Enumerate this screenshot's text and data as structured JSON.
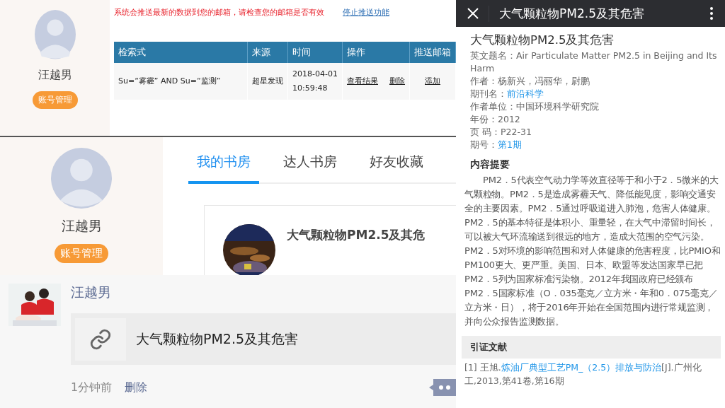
{
  "push_panel": {
    "profile": {
      "name": "汪越男",
      "button": "账号管理"
    },
    "notice": "系统会推送最新的数据到您的邮箱，请检查您的邮箱是否有效",
    "stop_link": "停止推送功能",
    "table": {
      "columns": [
        "检索式",
        "来源",
        "时间",
        "操作",
        "推送邮箱"
      ],
      "rows": [
        {
          "query": "Su=“雾霾” AND Su=“监测”",
          "source": "超星发现",
          "date": "2018-04-01",
          "time": "10:59:48",
          "view": "查看结果",
          "delete": "删除",
          "add": "添加"
        }
      ]
    }
  },
  "library_panel": {
    "profile": {
      "name": "汪越男",
      "button": "账号管理"
    },
    "tabs": [
      {
        "label": "我的书房",
        "selected": true
      },
      {
        "label": "达人书房",
        "selected": false
      },
      {
        "label": "好友收藏",
        "selected": false
      }
    ],
    "book": {
      "title": "大气颗粒物PM2.5及其危"
    }
  },
  "moment_panel": {
    "name": "汪越男",
    "link_title": "大气颗粒物PM2.5及其危害",
    "time": "1分钟前",
    "delete": "删除"
  },
  "article": {
    "header_title": "大气颗粒物PM2.5及其危害",
    "title": "大气颗粒物PM2.5及其危害",
    "fields": [
      {
        "label": "英文题名：",
        "value": "Air Particulate Matter PM2.5 in Beijing and Its Harm",
        "kind": "text"
      },
      {
        "label": "作者：",
        "value": "杨新兴，冯丽华，尉鹏",
        "kind": "text"
      },
      {
        "label": "期刊名：",
        "value": "前沿科学",
        "kind": "link"
      },
      {
        "label": "作者单位：",
        "value": "中国环境科学研究院",
        "kind": "text"
      },
      {
        "label": "年份：",
        "value": "2012",
        "kind": "text"
      },
      {
        "label": "页 码：",
        "value": "P22-31",
        "kind": "text"
      },
      {
        "label": "期号：",
        "value": "第1期",
        "kind": "link"
      }
    ],
    "abstract_heading": "内容提要",
    "abstract": "PM2．5代表空气动力学等效直径等于和小于2．5微米的大气颗粒物。PM2．5是造成雾霾天气、降低能见度，影响交通安全的主要因素。PM2．5通过呼吸道进入肺泡，危害人体健康。PM2．5的基本特征是体积小、重量轻，在大气中滞留时间长，可以被大气环流输送到很远的地方，造成大范围的空气污染。PM2．5对环境的影响范围和对人体健康的危害程度，比PMIO和PM100更大、更严重。美国、日本、欧盟等发达国家早已把PM2．5列为国家标准污染物。2012年我国政府已经颁布PM2．5国家标准（O．035毫克／立方米・年和0．075毫克／立方米・日），将于2016年开始在全国范围内进行常规监测，并向公众报告监测数据。",
    "references_heading": "引证文献",
    "references": [
      {
        "prefix": "[1] 王旭.",
        "link": "炼油厂典型工艺PM_（2.5）排放与防治",
        "suffix": "[J].广州化工,2013,第41卷,第16期"
      }
    ]
  }
}
